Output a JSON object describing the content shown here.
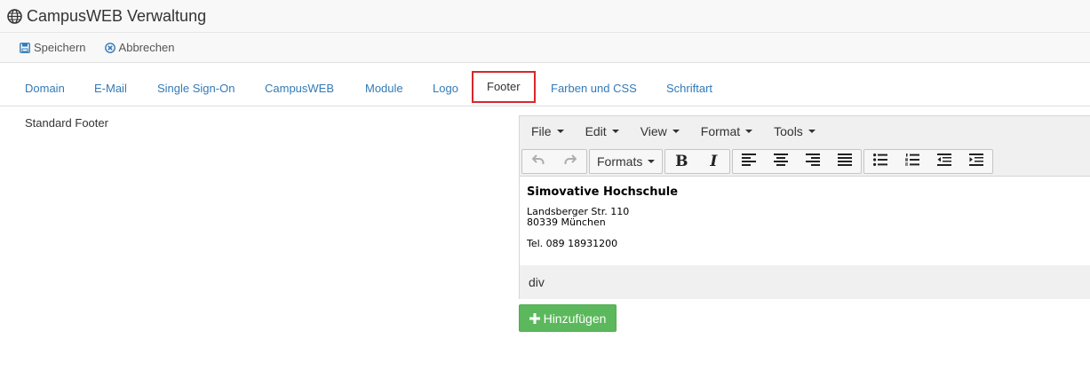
{
  "app": {
    "title": "CampusWEB Verwaltung",
    "globe_icon": "globe-icon"
  },
  "actions": [
    {
      "label": "Speichern",
      "icon": "save-icon"
    },
    {
      "label": "Abbrechen",
      "icon": "cancel-circle-icon"
    }
  ],
  "tabs": [
    {
      "label": "Domain"
    },
    {
      "label": "E-Mail"
    },
    {
      "label": "Single Sign-On"
    },
    {
      "label": "CampusWEB"
    },
    {
      "label": "Module"
    },
    {
      "label": "Logo"
    },
    {
      "label": "Footer",
      "active": true
    },
    {
      "label": "Farben und CSS"
    },
    {
      "label": "Schriftart"
    }
  ],
  "form": {
    "field_label": "Standard Footer"
  },
  "editor": {
    "menus": [
      "File",
      "Edit",
      "View",
      "Format",
      "Tools"
    ],
    "formats_label": "Formats",
    "bold_label": "B",
    "italic_label": "I",
    "content": {
      "org": "Simovative Hochschule",
      "street": "Landsberger Str. 110",
      "city": "80339 München",
      "phone": "Tel. 089 18931200"
    },
    "statusbar_path": "div"
  },
  "add_button": {
    "label": "Hinzufügen",
    "icon": "plus-icon"
  },
  "colors": {
    "link": "#337ab7",
    "active_tab_border": "#d9262c",
    "success": "#5cb85c"
  }
}
